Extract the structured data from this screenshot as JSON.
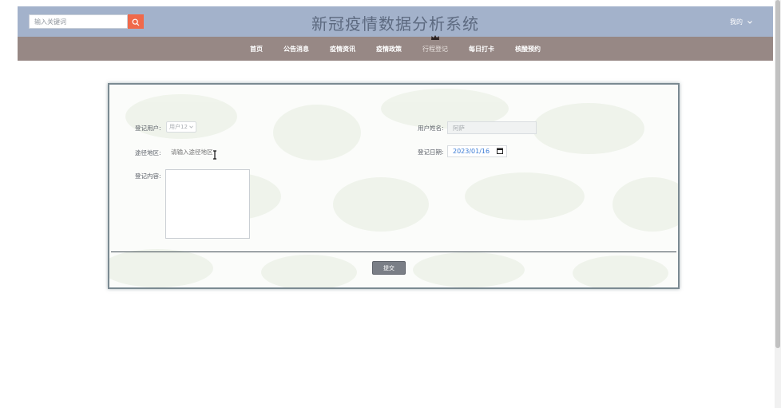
{
  "header": {
    "title": "新冠疫情数据分析系统",
    "search_placeholder": "输入关键词",
    "search_icon": "search-icon",
    "user_menu_label": "我的"
  },
  "nav": {
    "items": [
      "首页",
      "公告消息",
      "疫情资讯",
      "疫情政策",
      "行程登记",
      "每日打卡",
      "核酸预约"
    ],
    "active": "行程登记"
  },
  "form": {
    "user_label": "登记用户:",
    "user_value": "用户12",
    "route_label": "途径地区:",
    "route_placeholder": "请输入途径地区",
    "content_label": "登记内容:",
    "name_label": "用户姓名:",
    "name_value": "阿萨",
    "date_label": "登记日期:",
    "date_value": "2023/01/16",
    "submit_label": "提交"
  },
  "colors": {
    "header_bg": "#a3b2cb",
    "nav_bg": "#978885",
    "search_button": "#f0694a",
    "date_text": "#3a7bd5"
  }
}
